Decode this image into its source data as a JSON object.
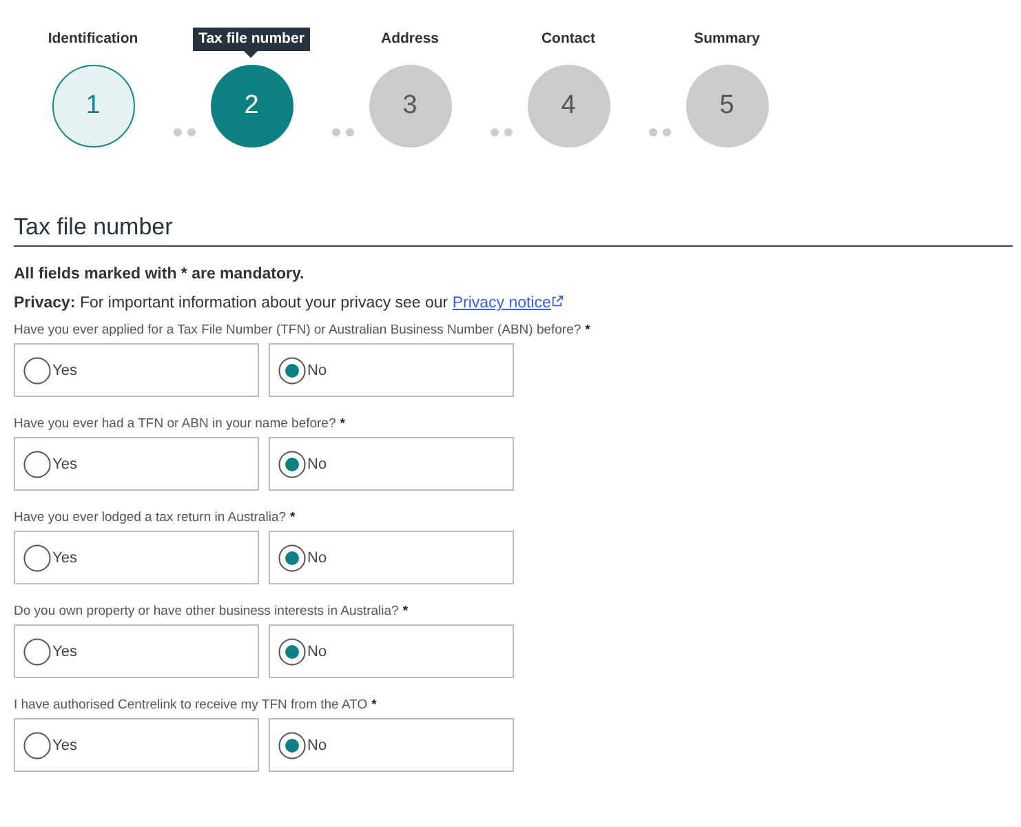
{
  "steps": [
    {
      "number": "1",
      "label": "Identification",
      "kind": "done"
    },
    {
      "number": "2",
      "label": "Tax file number",
      "kind": "current"
    },
    {
      "number": "3",
      "label": "Address",
      "kind": "todo"
    },
    {
      "number": "4",
      "label": "Contact",
      "kind": "todo"
    },
    {
      "number": "5",
      "label": "Summary",
      "kind": "todo"
    }
  ],
  "heading": "Tax file number",
  "mandatory_note": "All fields marked with * are mandatory.",
  "privacy": {
    "text": "**Privacy:** For important information about your privacy see our",
    "link": "Privacy notice"
  },
  "questions": [
    {
      "label": "Have you ever applied for a Tax File Number (TFN) or Australian Business Number (ABN) before?",
      "required_mark": "*",
      "options": [
        {
          "label": "Yes",
          "selected": false
        },
        {
          "label": "No",
          "selected": true
        }
      ]
    },
    {
      "label": "Have you ever had a TFN or ABN in your name before?",
      "required_mark": "*",
      "options": [
        {
          "label": "Yes",
          "selected": false
        },
        {
          "label": "No",
          "selected": true
        }
      ]
    },
    {
      "label": "Have you ever lodged a tax return in Australia?",
      "required_mark": "*",
      "options": [
        {
          "label": "Yes",
          "selected": false
        },
        {
          "label": "No",
          "selected": true
        }
      ]
    },
    {
      "label": "Do you own property or have other business interests in Australia?",
      "required_mark": "*",
      "options": [
        {
          "label": "Yes",
          "selected": false
        },
        {
          "label": "No",
          "selected": true
        }
      ]
    },
    {
      "label": "I have authorised Centrelink to receive my TFN from the ATO",
      "required_mark": "*",
      "options": [
        {
          "label": "Yes",
          "selected": false
        },
        {
          "label": "No",
          "selected": true
        }
      ]
    }
  ]
}
